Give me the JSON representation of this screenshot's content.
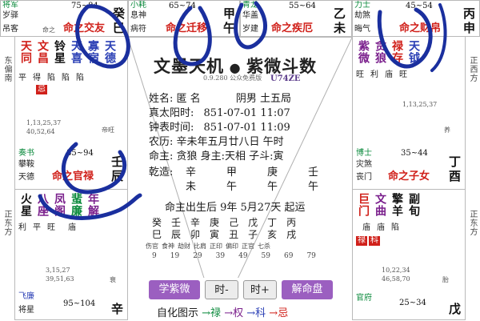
{
  "top": {
    "c0": {
      "star": "将军",
      "s1": "岁驿",
      "s2": "吊客",
      "age": "75~84",
      "pal": "命之交友",
      "stem": "癸",
      "br": "巳"
    },
    "c1": {
      "star": "小耗",
      "s1": "息神",
      "s2": "病符",
      "age": "65~74",
      "pal": "命之迁移",
      "stem": "甲",
      "br": "午"
    },
    "c2": {
      "star": "青龙",
      "s1": "华盖",
      "s2": "岁建",
      "age": "55~64",
      "pal": "命之疾厄",
      "stem": "乙",
      "br": "未"
    },
    "c3": {
      "star": "力士",
      "s1": "劫煞",
      "s2": "晦气",
      "age": "45~54",
      "pal": "命之财帛",
      "stem": "丙",
      "br": "申"
    }
  },
  "left": {
    "side_top": "东偏南",
    "side_bot": "正东方",
    "l1": {
      "stars": [
        "天同",
        "文昌",
        "铃星",
        "天喜",
        "寡宿",
        "天德"
      ],
      "br1": [
        "平",
        "得",
        "陷",
        "陷",
        "陷",
        ""
      ],
      "hua": "忌"
    },
    "l2": {
      "nums1": "1,13,25,37",
      "nums2": "40,52,64",
      "side": "帝旺"
    },
    "l3": {
      "star": "奏书",
      "s1": "攀鞍",
      "s2": "天德",
      "age": "85~94",
      "pal": "命之官禄",
      "stem": "壬",
      "br": "辰"
    },
    "l4": {
      "stars": [
        "火星",
        "八座",
        "凤阁",
        "蜚廉",
        "年解"
      ],
      "br1": [
        "利",
        "平",
        "旺",
        "",
        "庙"
      ]
    },
    "l5": {
      "nums1": "3,15,27",
      "nums2": "39,51,63",
      "side": "衰"
    },
    "l6": {
      "star": "飞廉",
      "s1": "将星",
      "age": "95~104",
      "stem": "辛"
    }
  },
  "right": {
    "side_top": "正西方",
    "side_bot": "正东方",
    "r1": {
      "stars": [
        "紫微",
        "贪狼",
        "禄存",
        "天钺"
      ],
      "br1": [
        "旺",
        "利",
        "庙",
        "旺"
      ]
    },
    "r2": {
      "nums1": "1,13,25,37",
      "nums2": "",
      "side": "养"
    },
    "r3": {
      "star": "博士",
      "s1": "灾煞",
      "s2": "丧门",
      "age": "35~44",
      "pal": "命之子女",
      "stem": "丁",
      "br": "酉"
    },
    "r4": {
      "stars": [
        "巨门",
        "文曲",
        "擎羊",
        "副旬"
      ],
      "br1": [
        "",
        "庙",
        "庙",
        "陷"
      ],
      "hua1": "禄",
      "hua2": "科"
    },
    "r5": {
      "nums1": "10,22,34",
      "nums2": "46,58,70",
      "side": "胎"
    },
    "r6": {
      "star": "官府",
      "age": "25~34",
      "stem": "戊"
    }
  },
  "center": {
    "title": "文墨天机",
    "title2": "紫微斗数",
    "version": "0.9.280 公众免费版",
    "brand": "U74ZE",
    "rows": [
      {
        "k": "姓名:",
        "v": "匿 名",
        "v2": "阴男 土五局"
      },
      {
        "k": "真太阳时:",
        "v": "851-07-01 11:07"
      },
      {
        "k": "钟表时间:",
        "v": "851-07-01 11:09"
      },
      {
        "k": "农历:",
        "v": "辛未年五月廿八日 午时"
      },
      {
        "k": "命主:",
        "v": "贪狼 身主:天相 子斗:寅"
      }
    ],
    "bazi_label": "乾造:",
    "bazi_top": [
      "辛",
      "甲",
      "庚",
      "壬"
    ],
    "bazi_bot": [
      "未",
      "午",
      "午",
      "午"
    ],
    "luck": "命主出生后 9年 5月27天 起运",
    "luck_stems": [
      "癸",
      "壬",
      "辛",
      "庚",
      "己",
      "戊",
      "丁",
      "丙"
    ],
    "luck_branches": [
      "巳",
      "辰",
      "卯",
      "寅",
      "丑",
      "子",
      "亥",
      "戌"
    ],
    "luck_gods": [
      "伤官",
      "食神",
      "劫财",
      "比肩",
      "正印",
      "偏印",
      "正官",
      "七杀"
    ],
    "luck_ages": [
      "9",
      "19",
      "29",
      "39",
      "49",
      "59",
      "69",
      "79"
    ],
    "buttons": {
      "learn": "学紫微",
      "prev": "时-",
      "next": "时+",
      "decode": "解命盘"
    },
    "footer": {
      "label": "自化图示",
      "lu": "→禄",
      "quan": "→权",
      "ke": "→科",
      "ji": "→忌"
    }
  }
}
